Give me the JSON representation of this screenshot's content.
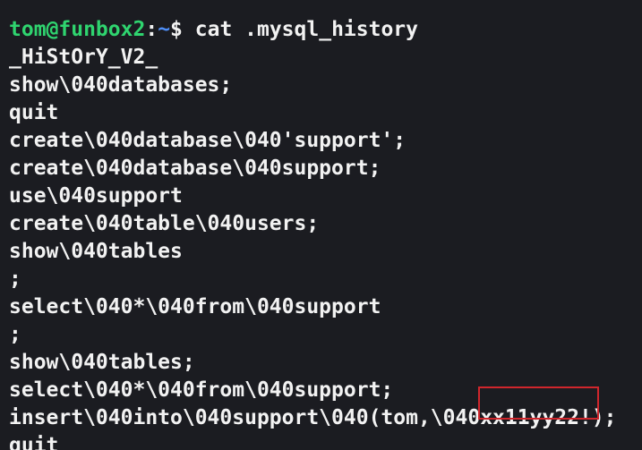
{
  "terminal": {
    "prompt": {
      "user_host": "tom@funbox2",
      "separator": ":",
      "path": "~",
      "symbol": "$ ",
      "command": "cat .mysql_history"
    },
    "output_lines": [
      "_HiStOrY_V2_",
      "show\\040databases;",
      "quit",
      "create\\040database\\040'support';",
      "create\\040database\\040support;",
      "use\\040support",
      "create\\040table\\040users;",
      "show\\040tables",
      ";",
      "select\\040*\\040from\\040support",
      ";",
      "show\\040tables;",
      "select\\040*\\040from\\040support;"
    ],
    "insert_line": {
      "prefix": "insert\\040into\\040support\\040(tom,\\040",
      "highlighted": "xx11yy22!",
      "suffix": ");"
    },
    "last_line": "quit"
  },
  "colors": {
    "background": "#1b1c21",
    "text": "#f2f2f2",
    "prompt_user": "#2fd46f",
    "prompt_path": "#4e8ef7",
    "highlight_box": "#d0262c"
  }
}
